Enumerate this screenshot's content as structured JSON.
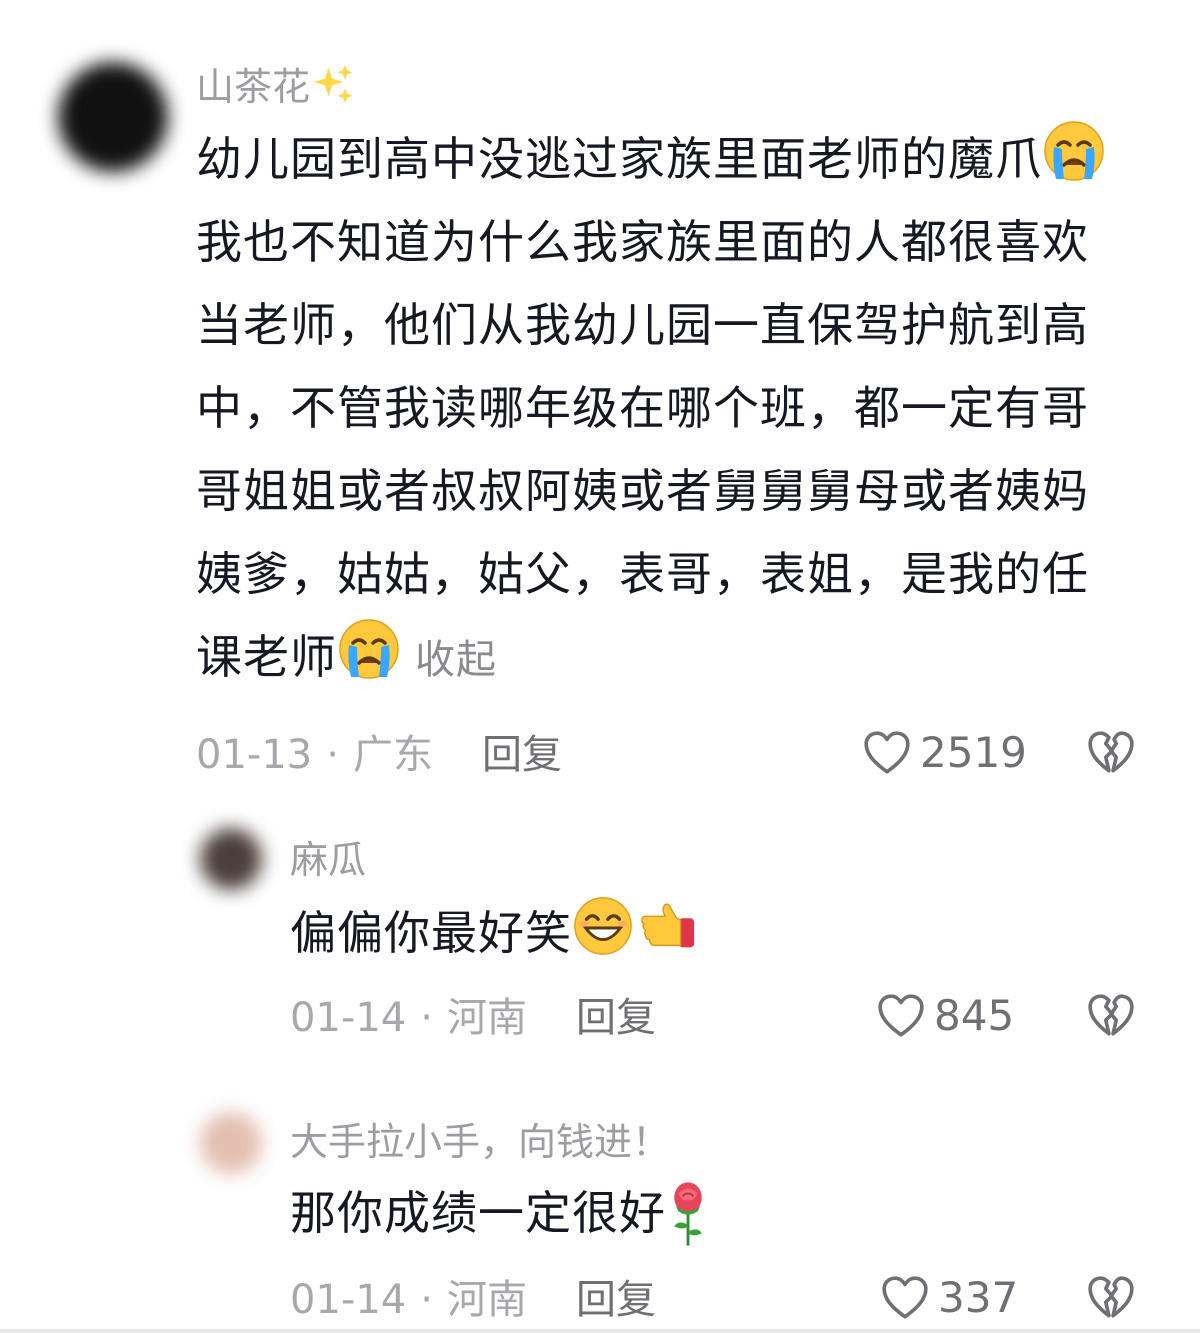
{
  "comments": [
    {
      "username": "山茶花",
      "username_emoji": "sparkles-icon",
      "lines": [
        "幼儿园到高中没逃过家族里面老师的魔爪",
        "我也不知道为什么我家族里面的人都很喜欢",
        "当老师，他们从我幼儿园一直保驾护航到高",
        "中，不管我读哪年级在哪个班，都一定有哥",
        "哥姐姐或者叔叔阿姨或者舅舅舅母或者姨妈",
        "姨爹，姑姑，姑父，表哥，表姐，是我的任",
        "课老师"
      ],
      "collapse_label": "收起",
      "date": "01-13",
      "location": "广东",
      "reply_label": "回复",
      "likes": "2519"
    },
    {
      "username": "麻瓜",
      "text": "偏偏你最好笑",
      "date": "01-14",
      "location": "河南",
      "reply_label": "回复",
      "likes": "845"
    },
    {
      "username": "大手拉小手，向钱进！",
      "text": "那你成绩一定很好",
      "date": "01-14",
      "location": "河南",
      "reply_label": "回复",
      "likes": "337"
    }
  ],
  "colors": {
    "text": "#161823",
    "secondary": "#9c9ca2",
    "meta": "#a8a8ac"
  }
}
